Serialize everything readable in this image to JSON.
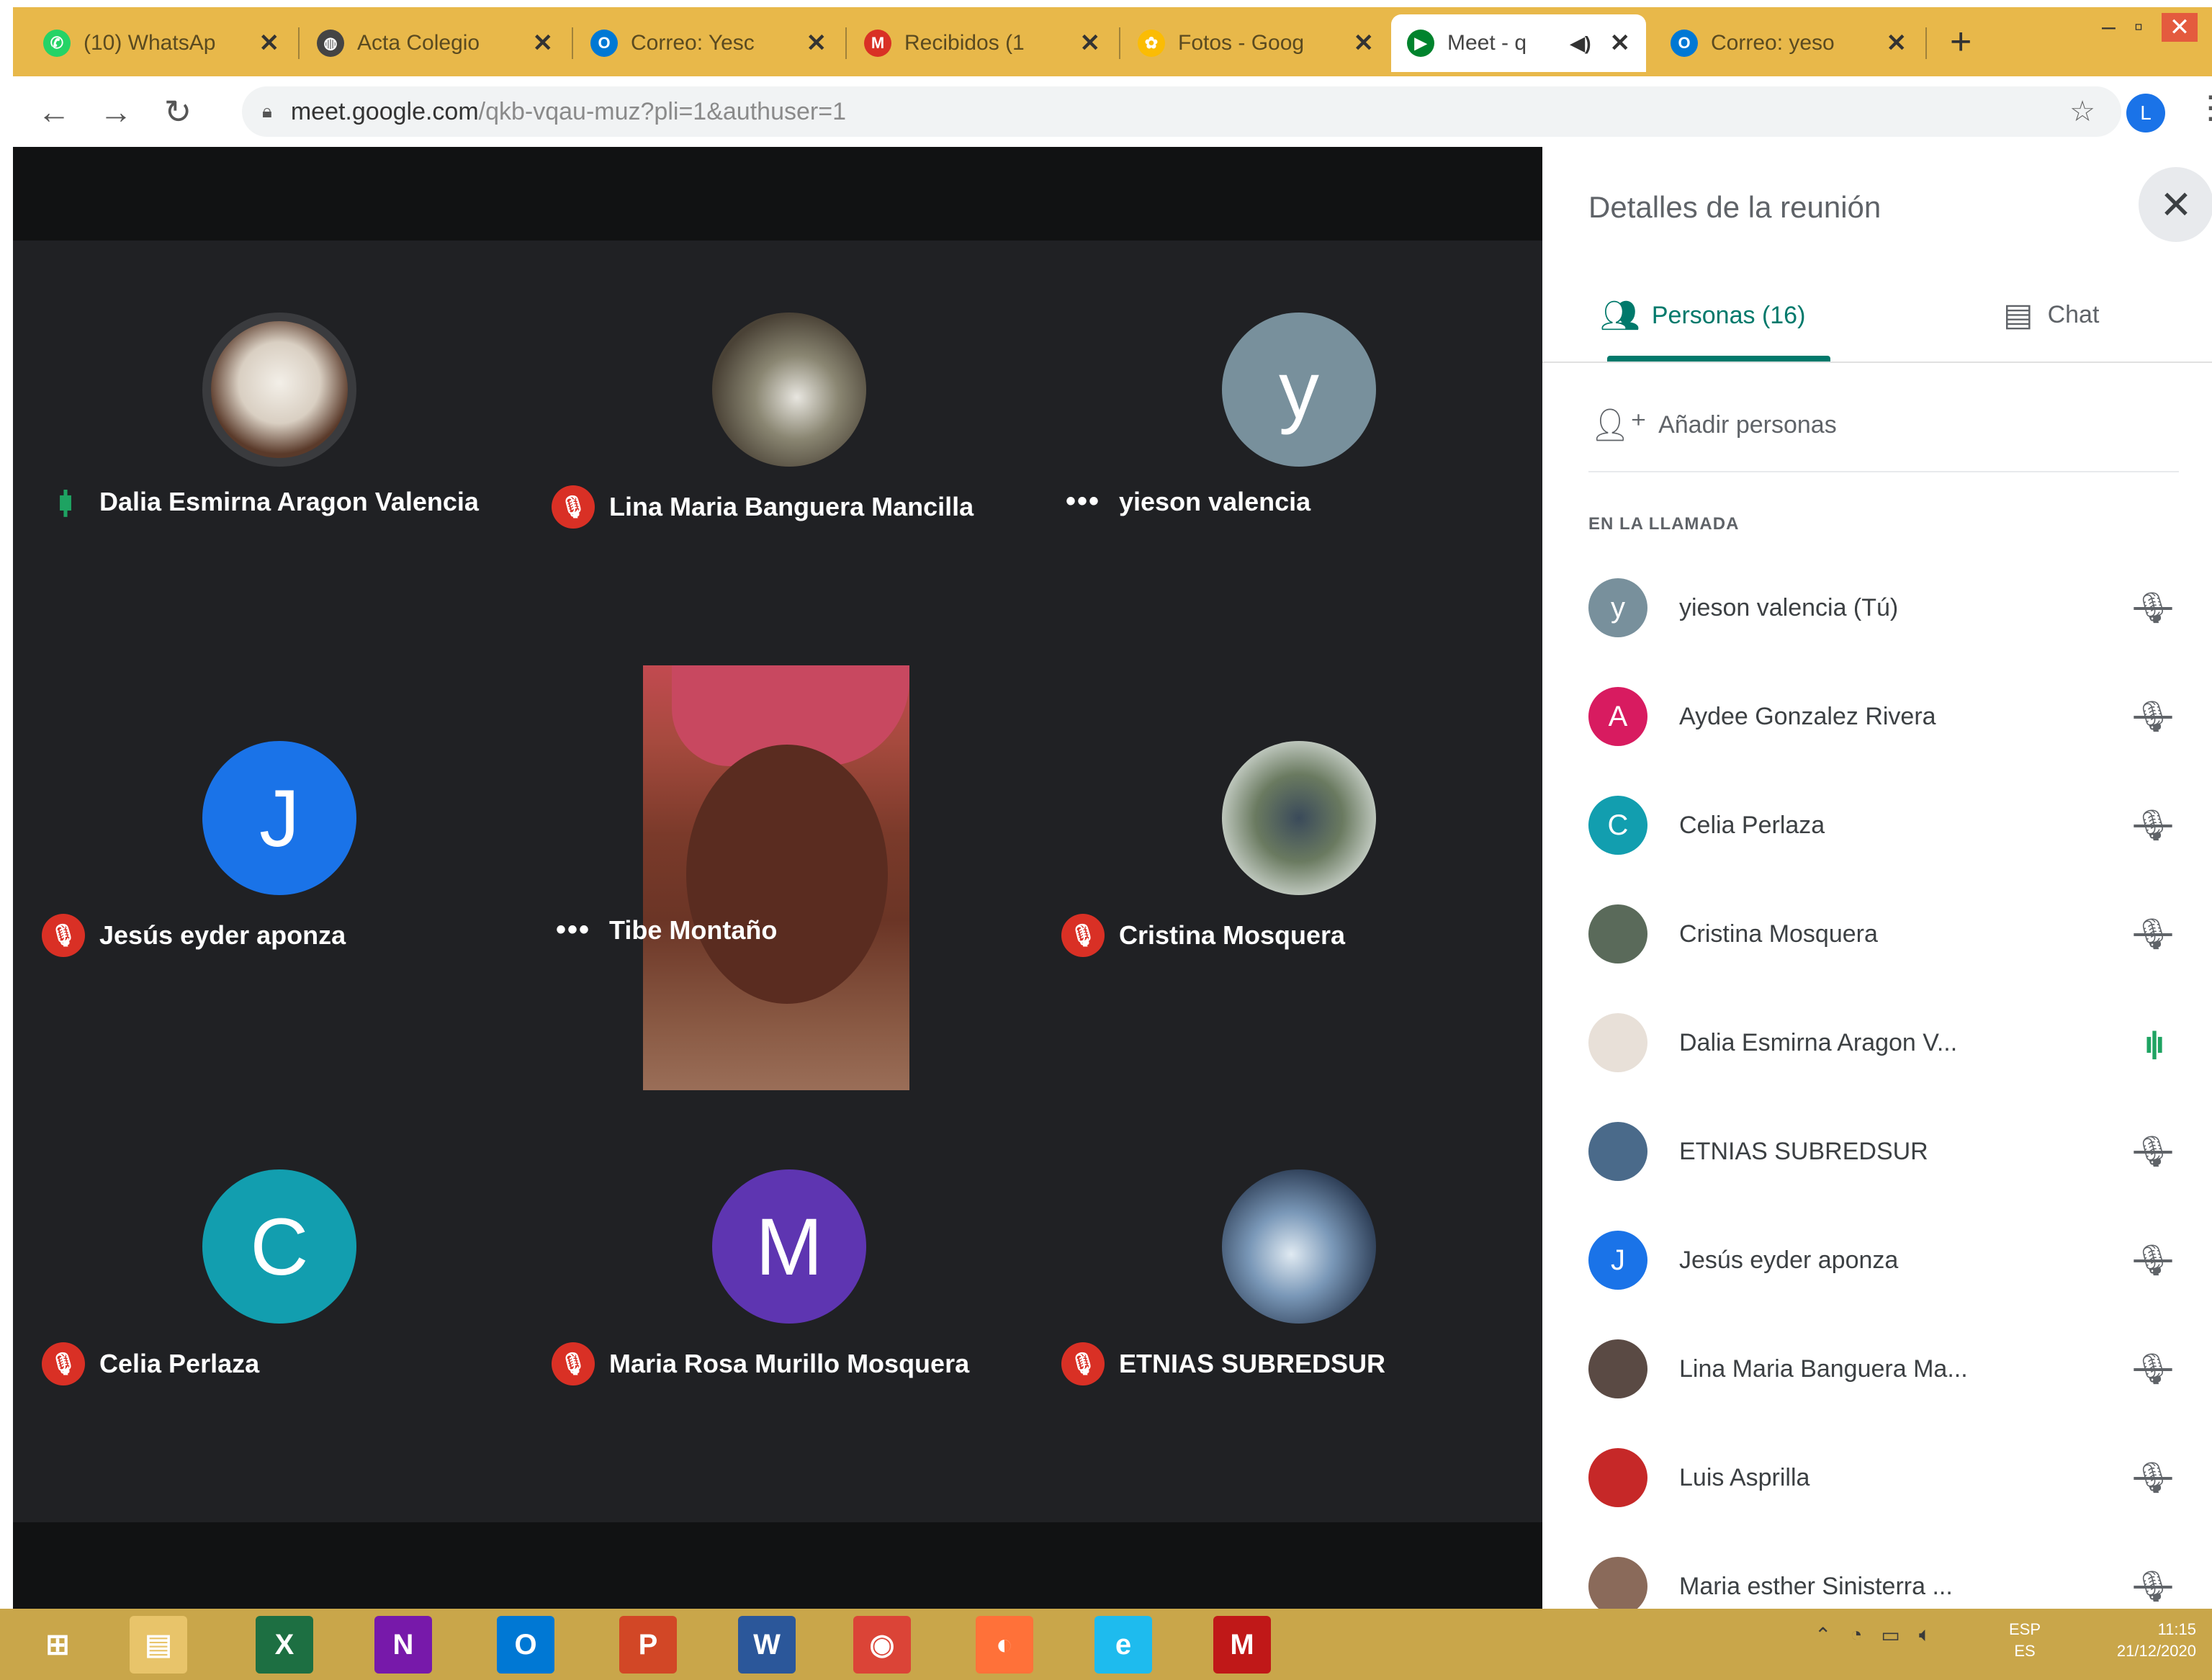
{
  "browser": {
    "tabs": [
      {
        "label": "(10) WhatsAp",
        "icon": "whatsapp-icon",
        "color": "#25d366"
      },
      {
        "label": "Acta Colegio",
        "icon": "globe-icon",
        "color": "#444444"
      },
      {
        "label": "Correo: Yesc",
        "icon": "outlook-icon",
        "color": "#0078d4"
      },
      {
        "label": "Recibidos (1",
        "icon": "gmail-icon",
        "color": "#d93025"
      },
      {
        "label": "Fotos - Goog",
        "icon": "photos-icon",
        "color": "#fbbc04"
      },
      {
        "label": "Meet - q",
        "icon": "meet-icon",
        "color": "#00832d",
        "active": true
      },
      {
        "label": "Correo: yeso",
        "icon": "outlook-icon",
        "color": "#0078d4"
      }
    ],
    "close_glyph": "✕",
    "new_tab": "+",
    "url_host": "meet.google.com",
    "url_path": "/qkb-vqau-muz?pli=1&authuser=1",
    "profile_initial": "L"
  },
  "stage": {
    "tiles": [
      {
        "name": "Dalia Esmirna Aragon Valencia",
        "status": "speaking",
        "avatar": "photo",
        "color": "#7a5a4a"
      },
      {
        "name": "Lina Maria Banguera Mancilla",
        "status": "muted",
        "avatar": "photo",
        "color": "#6a6f5a"
      },
      {
        "name": "yieson valencia",
        "status": "dots",
        "avatar": "y",
        "color": "#78909c"
      },
      {
        "name": "Jesús eyder aponza",
        "status": "muted",
        "avatar": "J",
        "color": "#1a73e8"
      },
      {
        "name": "Tibe Montaño",
        "status": "dots",
        "avatar": "video",
        "color": "#8a4a3a"
      },
      {
        "name": "Cristina Mosquera",
        "status": "muted",
        "avatar": "photo",
        "color": "#5a6a5a"
      },
      {
        "name": "Celia Perlaza",
        "status": "muted",
        "avatar": "C",
        "color": "#129eaf"
      },
      {
        "name": "Maria Rosa Murillo Mosquera",
        "status": "muted",
        "avatar": "M",
        "color": "#5e35b1"
      },
      {
        "name": "ETNIAS SUBREDSUR",
        "status": "muted",
        "avatar": "photo",
        "color": "#4a6a8a"
      }
    ]
  },
  "panel": {
    "title": "Detalles de la reunión",
    "close_glyph": "✕",
    "tab_people": "Personas (16)",
    "tab_chat": "Chat",
    "add_people": "Añadir personas",
    "section": "EN LA LLAMADA",
    "people": [
      {
        "name": "yieson valencia (Tú)",
        "initial": "y",
        "color": "#78909c",
        "mic": "muted",
        "action": "pin"
      },
      {
        "name": "Aydee Gonzalez Rivera",
        "initial": "A",
        "color": "#d81b60",
        "mic": "muted",
        "action": "more"
      },
      {
        "name": "Celia Perlaza",
        "initial": "C",
        "color": "#129eaf",
        "mic": "muted",
        "action": "more"
      },
      {
        "name": "Cristina Mosquera",
        "initial": "",
        "color": "#5a6a5a",
        "mic": "muted",
        "action": "more"
      },
      {
        "name": "Dalia Esmirna Aragon V...",
        "initial": "",
        "color": "#e8e0d8",
        "mic": "speaking",
        "action": "more"
      },
      {
        "name": "ETNIAS SUBREDSUR",
        "initial": "",
        "color": "#4a6a8a",
        "mic": "muted",
        "action": "more"
      },
      {
        "name": "Jesús eyder aponza",
        "initial": "J",
        "color": "#1a73e8",
        "mic": "muted",
        "action": "more"
      },
      {
        "name": "Lina Maria Banguera Ma...",
        "initial": "",
        "color": "#5a4a44",
        "mic": "muted",
        "action": "more"
      },
      {
        "name": "Luis Asprilla",
        "initial": "",
        "color": "#c62828",
        "mic": "muted",
        "action": "more"
      },
      {
        "name": "Maria esther Sinisterra ...",
        "initial": "",
        "color": "#8a6a5a",
        "mic": "muted",
        "action": "more"
      }
    ]
  },
  "taskbar": {
    "apps": [
      {
        "name": "start-button",
        "glyph": "⊞",
        "color": "#ffffff"
      },
      {
        "name": "file-explorer",
        "glyph": "▤",
        "color": "#e8c46a"
      },
      {
        "name": "excel",
        "glyph": "X",
        "color": "#1d6f42"
      },
      {
        "name": "onenote",
        "glyph": "N",
        "color": "#7719aa"
      },
      {
        "name": "outlook",
        "glyph": "O",
        "color": "#0078d4"
      },
      {
        "name": "powerpoint",
        "glyph": "P",
        "color": "#d24726"
      },
      {
        "name": "word",
        "glyph": "W",
        "color": "#2b579a"
      },
      {
        "name": "chrome",
        "glyph": "◉",
        "color": "#db4437"
      },
      {
        "name": "firefox",
        "glyph": "◐",
        "color": "#ff7139"
      },
      {
        "name": "internet-explorer",
        "glyph": "e",
        "color": "#1ebbee"
      },
      {
        "name": "mcafee",
        "glyph": "M",
        "color": "#c01818"
      }
    ],
    "lang": "ESP",
    "lang_sub": "ES",
    "time": "11:15",
    "date": "21/12/2020"
  }
}
